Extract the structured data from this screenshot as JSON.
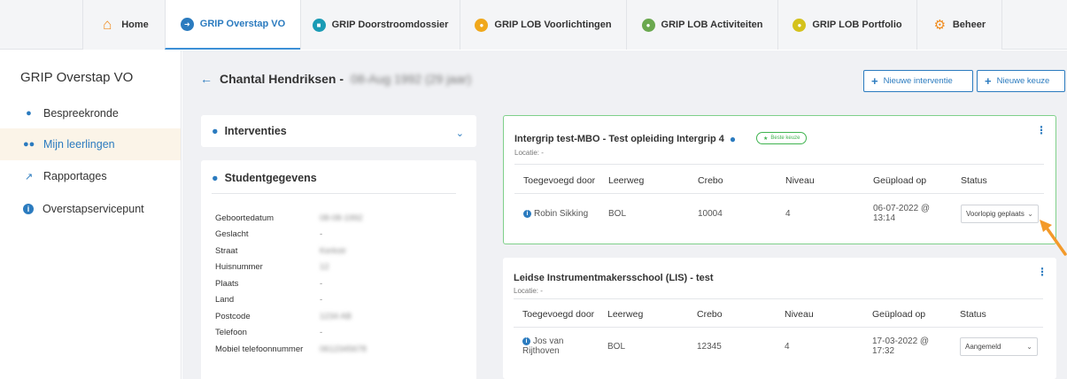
{
  "topnav": {
    "tabs": [
      {
        "label": "Home",
        "icon": "home-icon",
        "color": "#f08a1c"
      },
      {
        "label": "GRIP Overstap VO",
        "icon": "overstap-icon",
        "color": "#2b7bbf",
        "active": true
      },
      {
        "label": "GRIP Doorstroomdossier",
        "icon": "doorstroom-icon",
        "color": "#1a9bb5"
      },
      {
        "label": "GRIP LOB Voorlichtingen",
        "icon": "voorlichtingen-icon",
        "color": "#f0a81c"
      },
      {
        "label": "GRIP LOB Activiteiten",
        "icon": "activiteiten-icon",
        "color": "#6aa84f"
      },
      {
        "label": "GRIP LOB Portfolio",
        "icon": "portfolio-icon",
        "color": "#d4c21c"
      },
      {
        "label": "Beheer",
        "icon": "gear-icon",
        "color": "#f08a1c"
      }
    ]
  },
  "sidebar": {
    "title": "GRIP Overstap VO",
    "items": [
      {
        "label": "Bespreekronde",
        "icon": "chat-icon"
      },
      {
        "label": "Mijn leerlingen",
        "icon": "users-icon",
        "active": true
      },
      {
        "label": "Rapportages",
        "icon": "chart-icon"
      },
      {
        "label": "Overstapservicepunt",
        "icon": "info-icon"
      }
    ]
  },
  "header": {
    "student_name": "Chantal Hendriksen -",
    "student_dob_blurred": "08-Aug 1992 (29 jaar)",
    "buttons": {
      "new_intervention": "Nieuwe interventie",
      "new_choice": "Nieuwe keuze"
    }
  },
  "interventions": {
    "title": "Interventies"
  },
  "student_details": {
    "title": "Studentgegevens",
    "rows": [
      {
        "label": "Geboortedatum",
        "value": "08-08-1992",
        "blurred": true
      },
      {
        "label": "Geslacht",
        "value": "-"
      },
      {
        "label": "Straat",
        "value": "Kerkstr",
        "blurred": true
      },
      {
        "label": "Huisnummer",
        "value": "12",
        "blurred": true
      },
      {
        "label": "Plaats",
        "value": "-"
      },
      {
        "label": "Land",
        "value": "-"
      },
      {
        "label": "Postcode",
        "value": "1234 AB",
        "blurred": true
      },
      {
        "label": "Telefoon",
        "value": "-"
      },
      {
        "label": "Mobiel telefoonnummer",
        "value": "0612345678",
        "blurred": true
      }
    ]
  },
  "choices": [
    {
      "title": "Intergrip test-MBO - Test opleiding Intergrip 4",
      "location": "Locatie: -",
      "badge": "Beste keuze",
      "columns": [
        "Toegevoegd door",
        "Leerweg",
        "Crebo",
        "Niveau",
        "Geüpload op",
        "Status"
      ],
      "row": {
        "added_by": "Robin Sikking",
        "leerweg": "BOL",
        "crebo": "10004",
        "niveau": "4",
        "uploaded": "06-07-2022 @ 13:14",
        "status": "Voorlopig geplaatst"
      }
    },
    {
      "title": "Leidse Instrumentmakersschool (LIS) - test",
      "location": "Locatie: -",
      "columns": [
        "Toegevoegd door",
        "Leerweg",
        "Crebo",
        "Niveau",
        "Geüpload op",
        "Status"
      ],
      "row": {
        "added_by": "Jos van Rijthoven",
        "leerweg": "BOL",
        "crebo": "12345",
        "niveau": "4",
        "uploaded": "17-03-2022 @ 17:32",
        "status": "Aangemeld"
      }
    }
  ],
  "colors": {
    "accent": "#2b7bbf",
    "highlight_border": "#7fd08a",
    "badge_green": "#3fb34f",
    "arrow": "#f39a2a"
  }
}
